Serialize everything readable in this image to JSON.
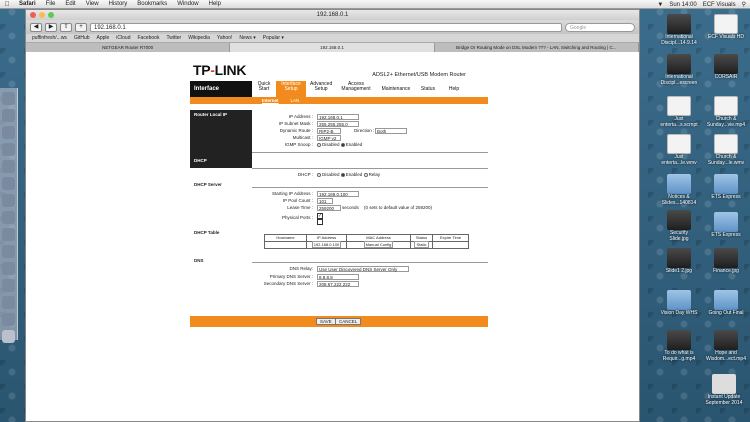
{
  "menubar": {
    "app": "Safari",
    "items": [
      "File",
      "Edit",
      "View",
      "History",
      "Bookmarks",
      "Window",
      "Help"
    ],
    "clock": "Sun 14:00",
    "user": "ECF Visuals"
  },
  "browser": {
    "title": "192.168.0.1",
    "url": "192.168.0.1",
    "search_placeholder": "Google",
    "bookmarks": [
      "puffinfresh/...ws",
      "GitHub",
      "Apple",
      "iCloud",
      "Facebook",
      "Twitter",
      "Wikipedia",
      "Yahoo!",
      "News ▾",
      "Popular ▾"
    ],
    "tabs": [
      {
        "label": "NETGEAR Router R7000",
        "active": false
      },
      {
        "label": "192.168.0.1",
        "active": true
      },
      {
        "label": "Bridge Or Routing Mode on DSL Modem ??? - LAN, Switching and Routing | C...",
        "active": false
      }
    ]
  },
  "router": {
    "logo": "TP-LINK",
    "product": "ADSL2+ Ethernet/USB Modem Router",
    "nav_section": "Interface",
    "nav": [
      "Quick Start",
      "Interface Setup",
      "Advanced Setup",
      "Access Management",
      "Maintenance",
      "Status",
      "Help"
    ],
    "subnav": [
      "Internet",
      "LAN"
    ],
    "router_local_ip": {
      "section": "Router Local IP",
      "ip_label": "IP Address :",
      "ip": "192.168.0.1",
      "mask_label": "IP Subnet Mask :",
      "mask": "255.255.255.0",
      "route_label": "Dynamic Route :",
      "route": "RIP2-B",
      "direction_label": "Direction :",
      "direction": "Both",
      "multicast_label": "Multicast :",
      "multicast": "IGMP v2",
      "igmp_label": "IGMP Snoop :",
      "igmp_options": [
        "Disabled",
        "Enabled"
      ]
    },
    "dhcp": {
      "section": "DHCP",
      "label": "DHCP :",
      "options": [
        "Disabled",
        "Enabled",
        "Relay"
      ]
    },
    "dhcp_server": {
      "section": "DHCP Server",
      "start_label": "Starting IP Address :",
      "start": "192.168.0.100",
      "pool_label": "IP Pool Count :",
      "pool": "101",
      "lease_label": "Lease Time :",
      "lease": "259200",
      "lease_unit": "seconds",
      "lease_note": "(0 sets to default value of 259200)",
      "ports_label": "Physical Ports :"
    },
    "dhcp_table": {
      "section": "DHCP Table",
      "headers": [
        "Hostname",
        "IP Address",
        "MAC Address",
        "Status",
        "Expire Time"
      ],
      "ip": "192.168.0.100",
      "config": "Manual Config",
      "status": "Static"
    },
    "dns": {
      "section": "DNS",
      "relay_label": "DNS Relay:",
      "relay": "Use User Discovered DNS Server Only",
      "primary_label": "Primary DNS Server :",
      "primary": "8.8.8.8",
      "secondary_label": "Secondary DNS Server :",
      "secondary": "208.67.222.222"
    },
    "buttons": {
      "save": "SAVE",
      "cancel": "CANCEL"
    }
  },
  "desktop": [
    {
      "label": "International Discipl...14.9.14",
      "kind": "img"
    },
    {
      "label": "ECF Visuals HD",
      "kind": "doc"
    },
    {
      "label": "International Discipl...escreen",
      "kind": "img"
    },
    {
      "label": "CORSAIR",
      "kind": "img"
    },
    {
      "label": "Just enterta...s.scrnpt",
      "kind": "doc"
    },
    {
      "label": "Church & Sunday...vie.mp4",
      "kind": "doc"
    },
    {
      "label": "Just enterta...le.wmv",
      "kind": "doc"
    },
    {
      "label": "Church & Sunday...le.wmv",
      "kind": "doc"
    },
    {
      "label": "Notices & Slides...140814",
      "kind": "folder"
    },
    {
      "label": "ETS Express",
      "kind": "folder"
    },
    {
      "label": "Security Slide.jpg",
      "kind": "img"
    },
    {
      "label": "ETS Express",
      "kind": "folder"
    },
    {
      "label": "Slide1 2.jpg",
      "kind": "img"
    },
    {
      "label": "Finance.jpg",
      "kind": "img"
    },
    {
      "label": "Vision Day WHS",
      "kind": "folder"
    },
    {
      "label": "Going Out Final",
      "kind": "folder"
    },
    {
      "label": "To do what is Requir...g.mp4",
      "kind": "img"
    },
    {
      "label": "Hope and Wisdom...ect.mp4",
      "kind": "img"
    },
    {
      "label": "Instant Update September 2014",
      "kind": "img"
    }
  ]
}
